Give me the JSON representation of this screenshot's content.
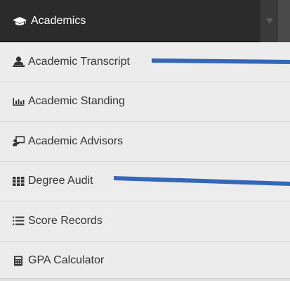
{
  "header": {
    "title": "Academics",
    "icon": "graduation-cap-icon"
  },
  "items": [
    {
      "label": "Academic Transcript",
      "icon": "user-icon"
    },
    {
      "label": "Academic Standing",
      "icon": "bar-chart-icon"
    },
    {
      "label": "Academic Advisors",
      "icon": "presentation-board-icon"
    },
    {
      "label": "Degree Audit",
      "icon": "grid-table-icon"
    },
    {
      "label": "Score Records",
      "icon": "list-icon"
    },
    {
      "label": "GPA Calculator",
      "icon": "calculator-icon"
    }
  ],
  "colors": {
    "header_bg": "#2b2b2b",
    "menu_bg": "#ececec",
    "text": "#333333",
    "annotation": "#3567b9"
  }
}
